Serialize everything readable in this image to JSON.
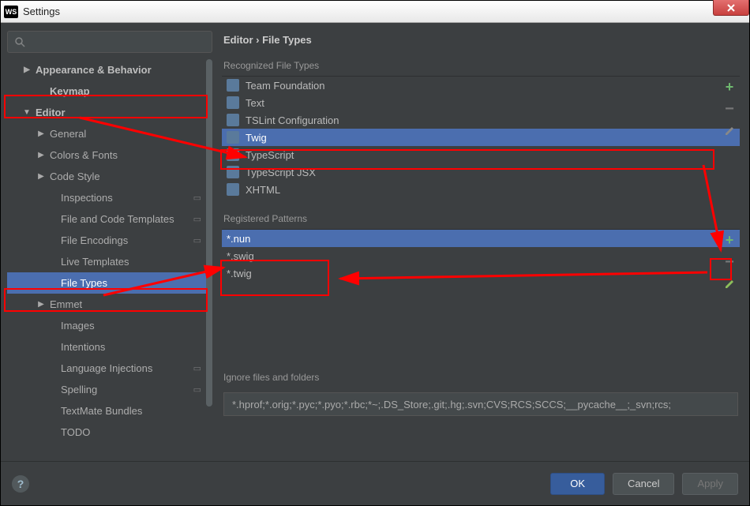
{
  "window": {
    "title": "Settings",
    "icon_text": "WS"
  },
  "breadcrumb": "Editor › File Types",
  "sidebar": {
    "items": [
      {
        "label": "Appearance & Behavior",
        "level": 1,
        "bold": true,
        "arrow": "right",
        "proj": false
      },
      {
        "label": "Keymap",
        "level": 2,
        "bold": true,
        "arrow": "",
        "proj": false
      },
      {
        "label": "Editor",
        "level": 1,
        "bold": true,
        "arrow": "down",
        "proj": false
      },
      {
        "label": "General",
        "level": 2,
        "bold": false,
        "arrow": "right",
        "proj": false
      },
      {
        "label": "Colors & Fonts",
        "level": 2,
        "bold": false,
        "arrow": "right",
        "proj": false
      },
      {
        "label": "Code Style",
        "level": 2,
        "bold": false,
        "arrow": "right",
        "proj": false
      },
      {
        "label": "Inspections",
        "level": 3,
        "bold": false,
        "arrow": "",
        "proj": true
      },
      {
        "label": "File and Code Templates",
        "level": 3,
        "bold": false,
        "arrow": "",
        "proj": true
      },
      {
        "label": "File Encodings",
        "level": 3,
        "bold": false,
        "arrow": "",
        "proj": true
      },
      {
        "label": "Live Templates",
        "level": 3,
        "bold": false,
        "arrow": "",
        "proj": false
      },
      {
        "label": "File Types",
        "level": 3,
        "bold": false,
        "arrow": "",
        "proj": false,
        "selected": true
      },
      {
        "label": "Emmet",
        "level": 2,
        "bold": false,
        "arrow": "right",
        "proj": false
      },
      {
        "label": "Images",
        "level": 3,
        "bold": false,
        "arrow": "",
        "proj": false
      },
      {
        "label": "Intentions",
        "level": 3,
        "bold": false,
        "arrow": "",
        "proj": false
      },
      {
        "label": "Language Injections",
        "level": 3,
        "bold": false,
        "arrow": "",
        "proj": true
      },
      {
        "label": "Spelling",
        "level": 3,
        "bold": false,
        "arrow": "",
        "proj": true
      },
      {
        "label": "TextMate Bundles",
        "level": 3,
        "bold": false,
        "arrow": "",
        "proj": false
      },
      {
        "label": "TODO",
        "level": 3,
        "bold": false,
        "arrow": "",
        "proj": false
      }
    ]
  },
  "sections": {
    "recognized_label": "Recognized File Types",
    "patterns_label": "Registered Patterns",
    "ignore_label": "Ignore files and folders"
  },
  "file_types": [
    {
      "label": "Team Foundation",
      "selected": false
    },
    {
      "label": "Text",
      "selected": false
    },
    {
      "label": "TSLint Configuration",
      "selected": false
    },
    {
      "label": "Twig",
      "selected": true
    },
    {
      "label": "TypeScript",
      "selected": false
    },
    {
      "label": "TypeScript JSX",
      "selected": false
    },
    {
      "label": "XHTML",
      "selected": false
    }
  ],
  "patterns": [
    {
      "label": "*.nun",
      "selected": true
    },
    {
      "label": "*.swig",
      "selected": false
    },
    {
      "label": "*.twig",
      "selected": false
    }
  ],
  "ignore_value": "*.hprof;*.orig;*.pyc;*.pyo;*.rbc;*~;.DS_Store;.git;.hg;.svn;CVS;RCS;SCCS;__pycache__;_svn;rcs;",
  "buttons": {
    "ok": "OK",
    "cancel": "Cancel",
    "apply": "Apply"
  }
}
